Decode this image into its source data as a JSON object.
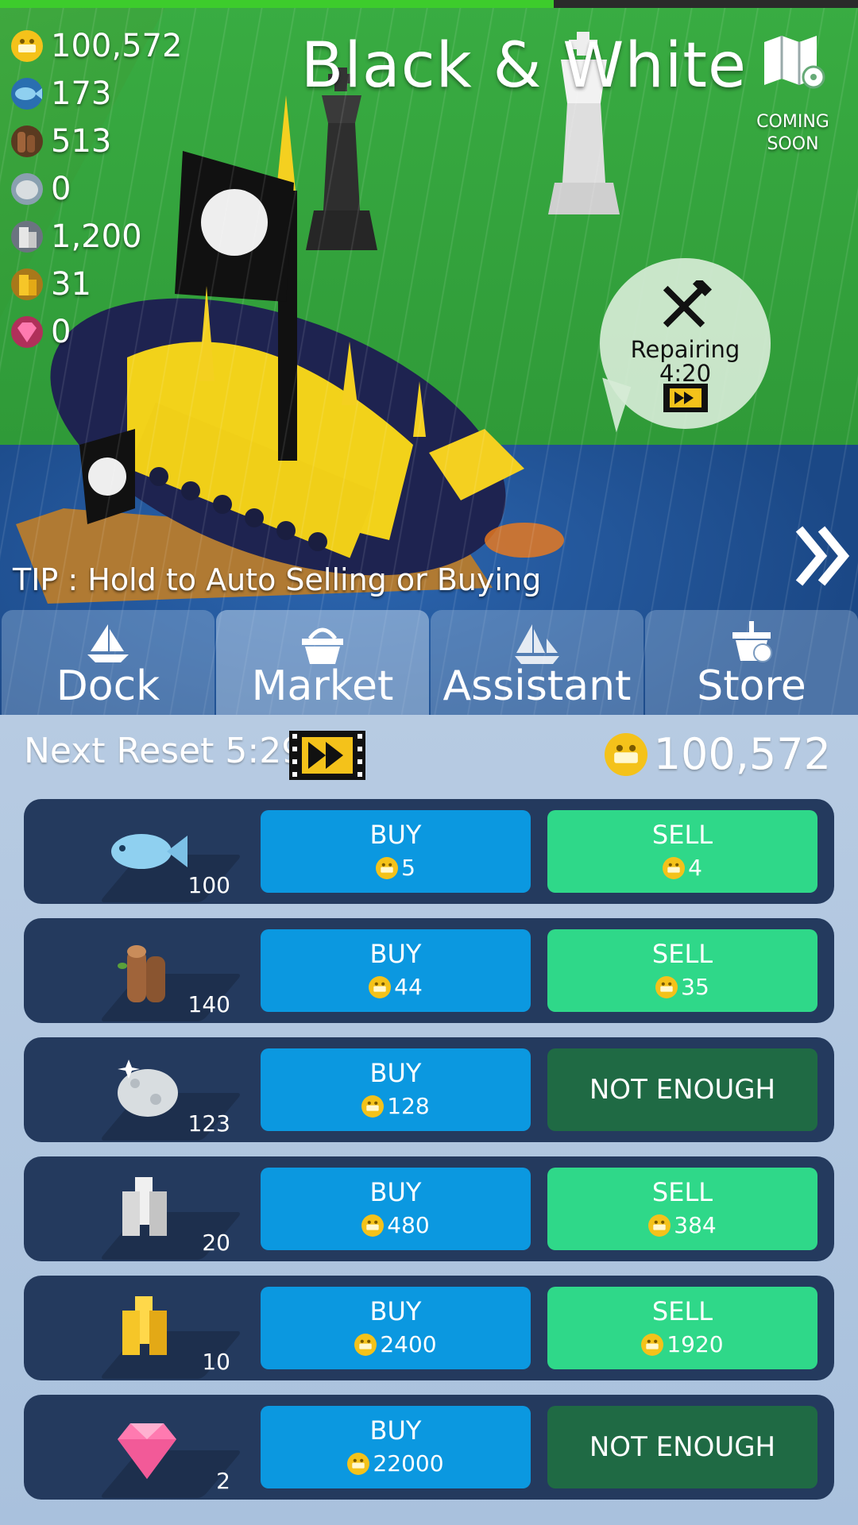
{
  "progress": {
    "fraction": 0.645
  },
  "resources": [
    {
      "name": "coins",
      "value": "100,572"
    },
    {
      "name": "fish",
      "value": "173"
    },
    {
      "name": "wood",
      "value": "513"
    },
    {
      "name": "stone",
      "value": "0"
    },
    {
      "name": "silver",
      "value": "1,200"
    },
    {
      "name": "gold",
      "value": "31"
    },
    {
      "name": "gem",
      "value": "0"
    }
  ],
  "header": {
    "title": "Black & White",
    "coming_soon": "COMING\nSOON"
  },
  "repair": {
    "label": "Repairing",
    "time": "4:20"
  },
  "tip": "TIP : Hold to Auto Selling or Buying",
  "tabs": [
    {
      "label": "Dock"
    },
    {
      "label": "Market"
    },
    {
      "label": "Assistant"
    },
    {
      "label": "Store"
    }
  ],
  "market": {
    "reset_label": "Next Reset 5:29",
    "gold_total": "100,572",
    "rows": [
      {
        "item": "fish",
        "qty": "100",
        "buy_label": "BUY",
        "buy_price": "5",
        "sell_label": "SELL",
        "sell_price": "4"
      },
      {
        "item": "wood",
        "qty": "140",
        "buy_label": "BUY",
        "buy_price": "44",
        "sell_label": "SELL",
        "sell_price": "35"
      },
      {
        "item": "stone",
        "qty": "123",
        "buy_label": "BUY",
        "buy_price": "128",
        "sell_label": "NOT ENOUGH",
        "sell_price": ""
      },
      {
        "item": "silver",
        "qty": "20",
        "buy_label": "BUY",
        "buy_price": "480",
        "sell_label": "SELL",
        "sell_price": "384"
      },
      {
        "item": "gold",
        "qty": "10",
        "buy_label": "BUY",
        "buy_price": "2400",
        "sell_label": "SELL",
        "sell_price": "1920"
      },
      {
        "item": "gem",
        "qty": "2",
        "buy_label": "BUY",
        "buy_price": "22000",
        "sell_label": "NOT ENOUGH",
        "sell_price": ""
      }
    ]
  },
  "colors": {
    "buy": "#0b98e0",
    "sell": "#2fd889",
    "not_enough": "#1f6a44",
    "row_bg": "#243a5e",
    "coin": "#f4c21a",
    "progress": "#3dcc2c"
  }
}
